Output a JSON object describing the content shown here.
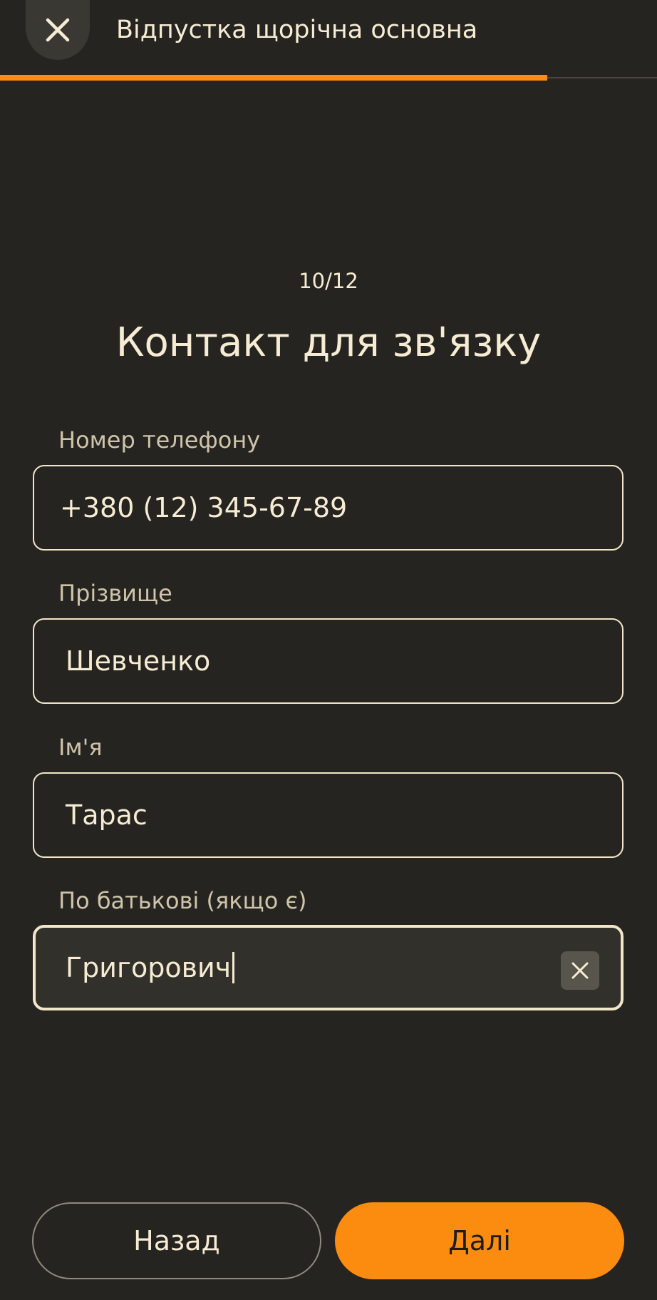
{
  "header": {
    "title": "Відпустка щорічна основна",
    "close_icon": "close-icon"
  },
  "progress": {
    "fraction": 0.833,
    "accent_color": "#fb8c10"
  },
  "step": {
    "counter": "10/12"
  },
  "page_title": "Контакт для зв'язку",
  "fields": [
    {
      "label": "Номер телефону",
      "value": "+380  (12) 345-67-89"
    },
    {
      "label": "Прізвище",
      "value": "Шевченко"
    },
    {
      "label": "Ім'я",
      "value": "Тарас"
    },
    {
      "label": "По батькові (якщо є)",
      "value": "Григорович",
      "focused": true,
      "clear_icon": "clear-icon"
    }
  ],
  "buttons": {
    "back_label": "Назад",
    "next_label": "Далі"
  }
}
